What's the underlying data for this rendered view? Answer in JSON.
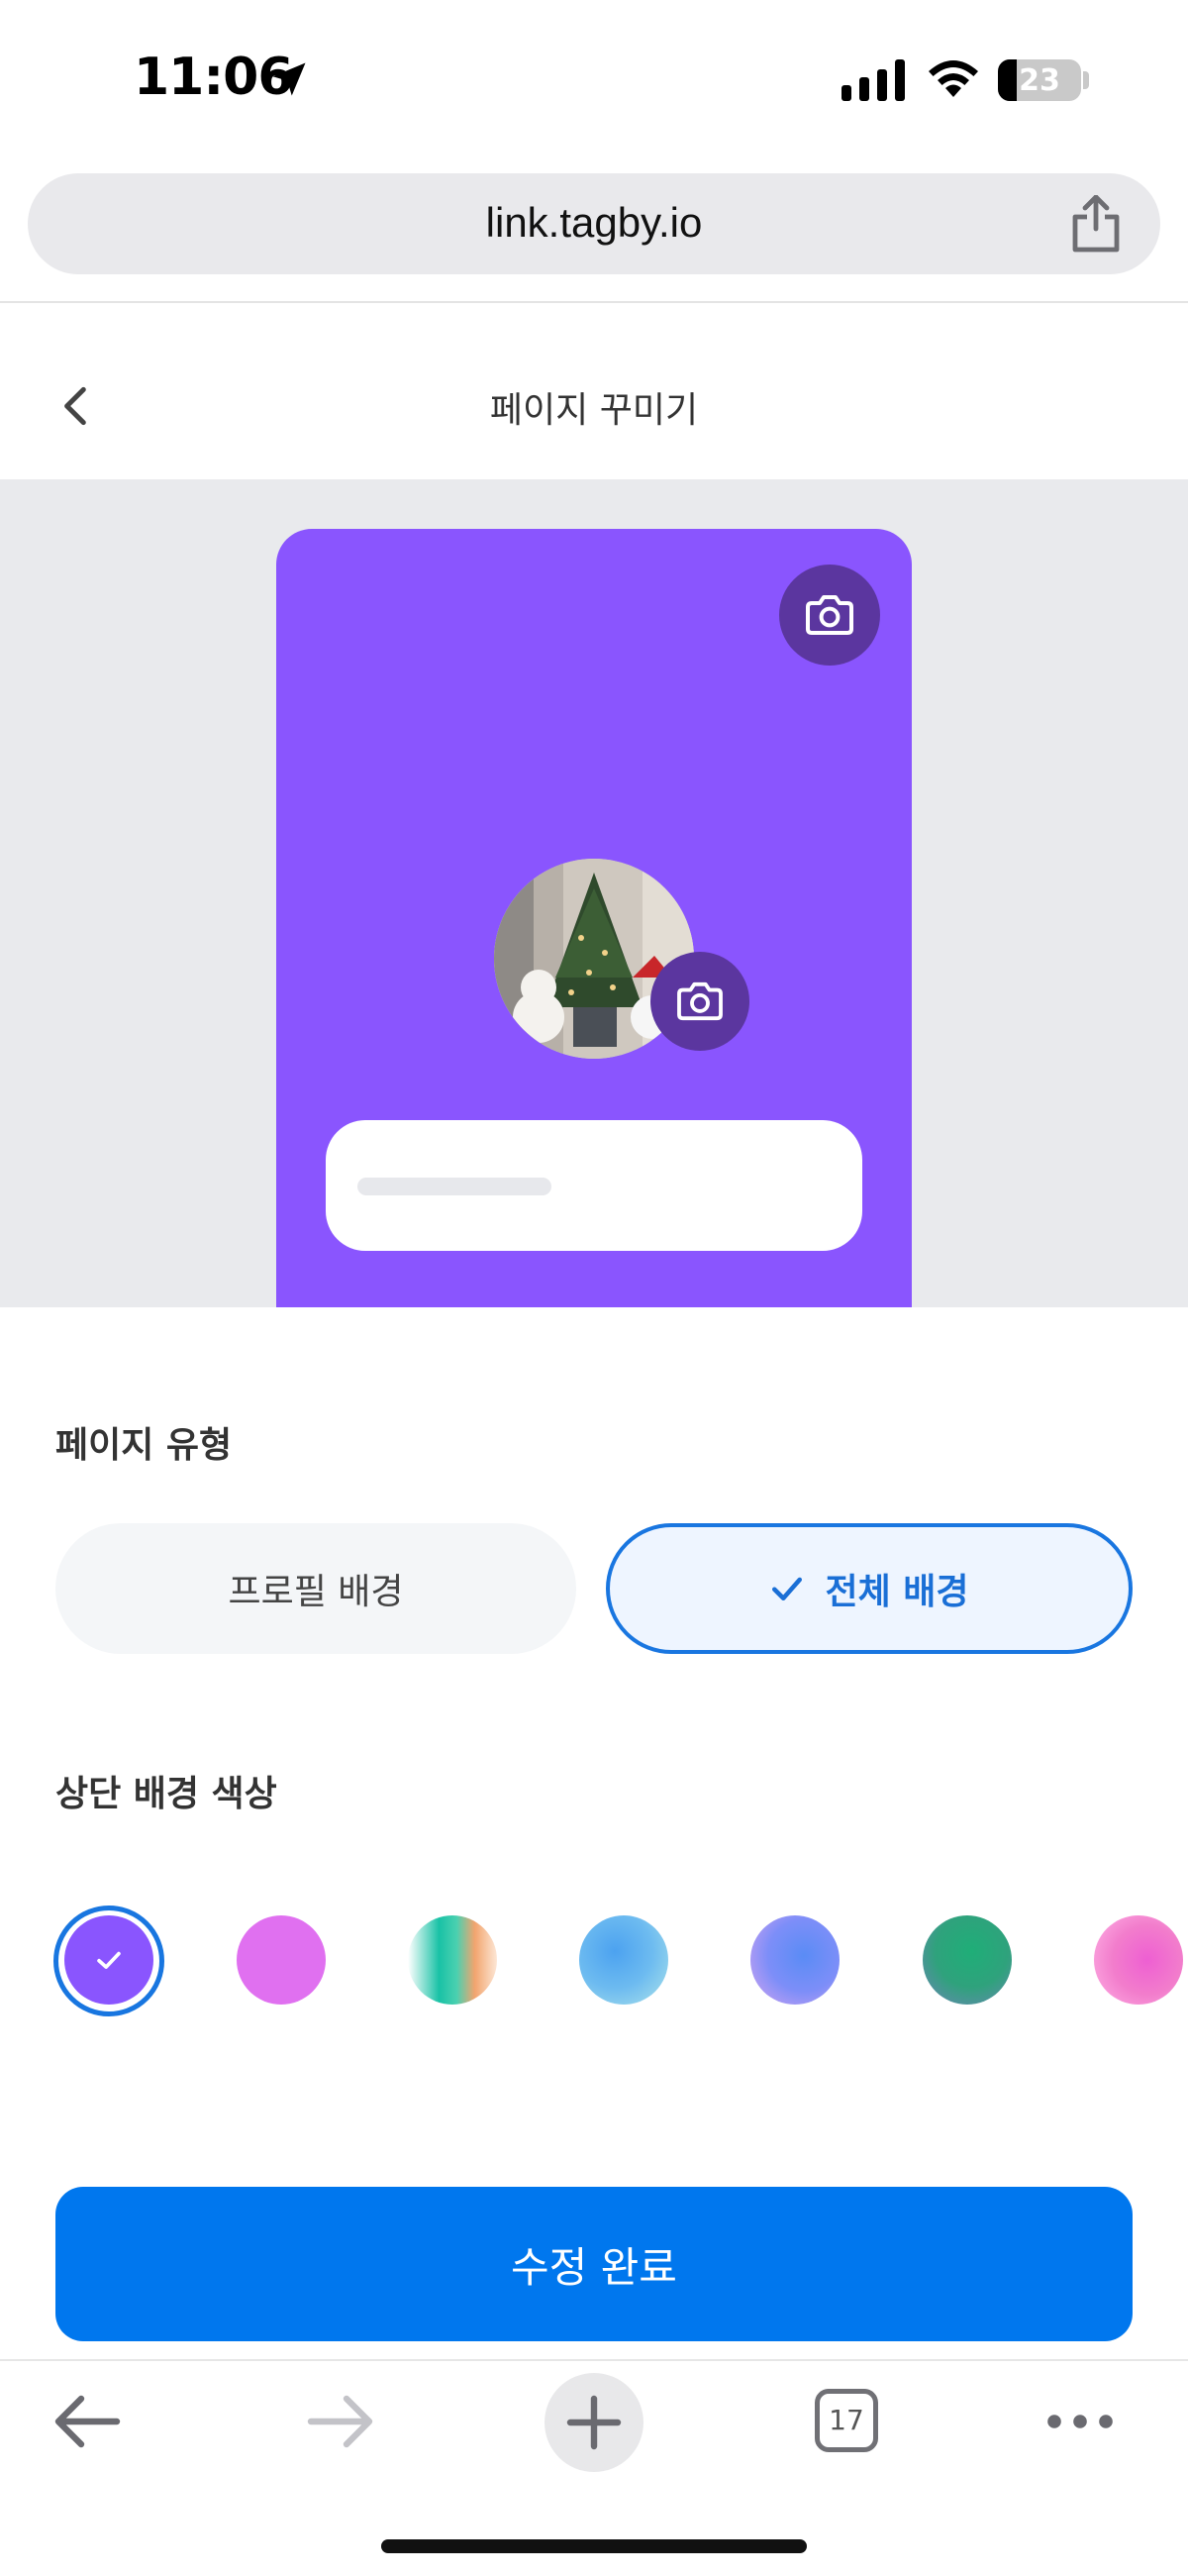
{
  "status_bar": {
    "time": "11:06",
    "battery_percent": "23",
    "battery_level": 0.23
  },
  "browser": {
    "url": "link.tagby.io",
    "tab_count": "17"
  },
  "header": {
    "title": "페이지 꾸미기"
  },
  "preview": {
    "background_color": "#8a55fe"
  },
  "page_type": {
    "label": "페이지 유형",
    "options": [
      {
        "label": "프로필 배경",
        "selected": false
      },
      {
        "label": "전체 배경",
        "selected": true
      }
    ]
  },
  "top_color": {
    "label": "상단 배경 색상",
    "swatches": [
      {
        "name": "purple",
        "color": "#8a55fe",
        "selected": true
      },
      {
        "name": "pink",
        "color": "#e070f0"
      },
      {
        "name": "teal-orange-gradient",
        "color": "#2cc3a5"
      },
      {
        "name": "blue-gradient",
        "color": "#6ab4f0"
      },
      {
        "name": "blue-violet-gradient",
        "color": "#7a8cf8"
      },
      {
        "name": "green-blue-gradient",
        "color": "#30a27a"
      },
      {
        "name": "pink-gradient",
        "color": "#f07ad0"
      }
    ]
  },
  "submit": {
    "label": "수정 완료"
  },
  "colors": {
    "accent": "#0077ee",
    "selected_border": "#1976e0"
  }
}
